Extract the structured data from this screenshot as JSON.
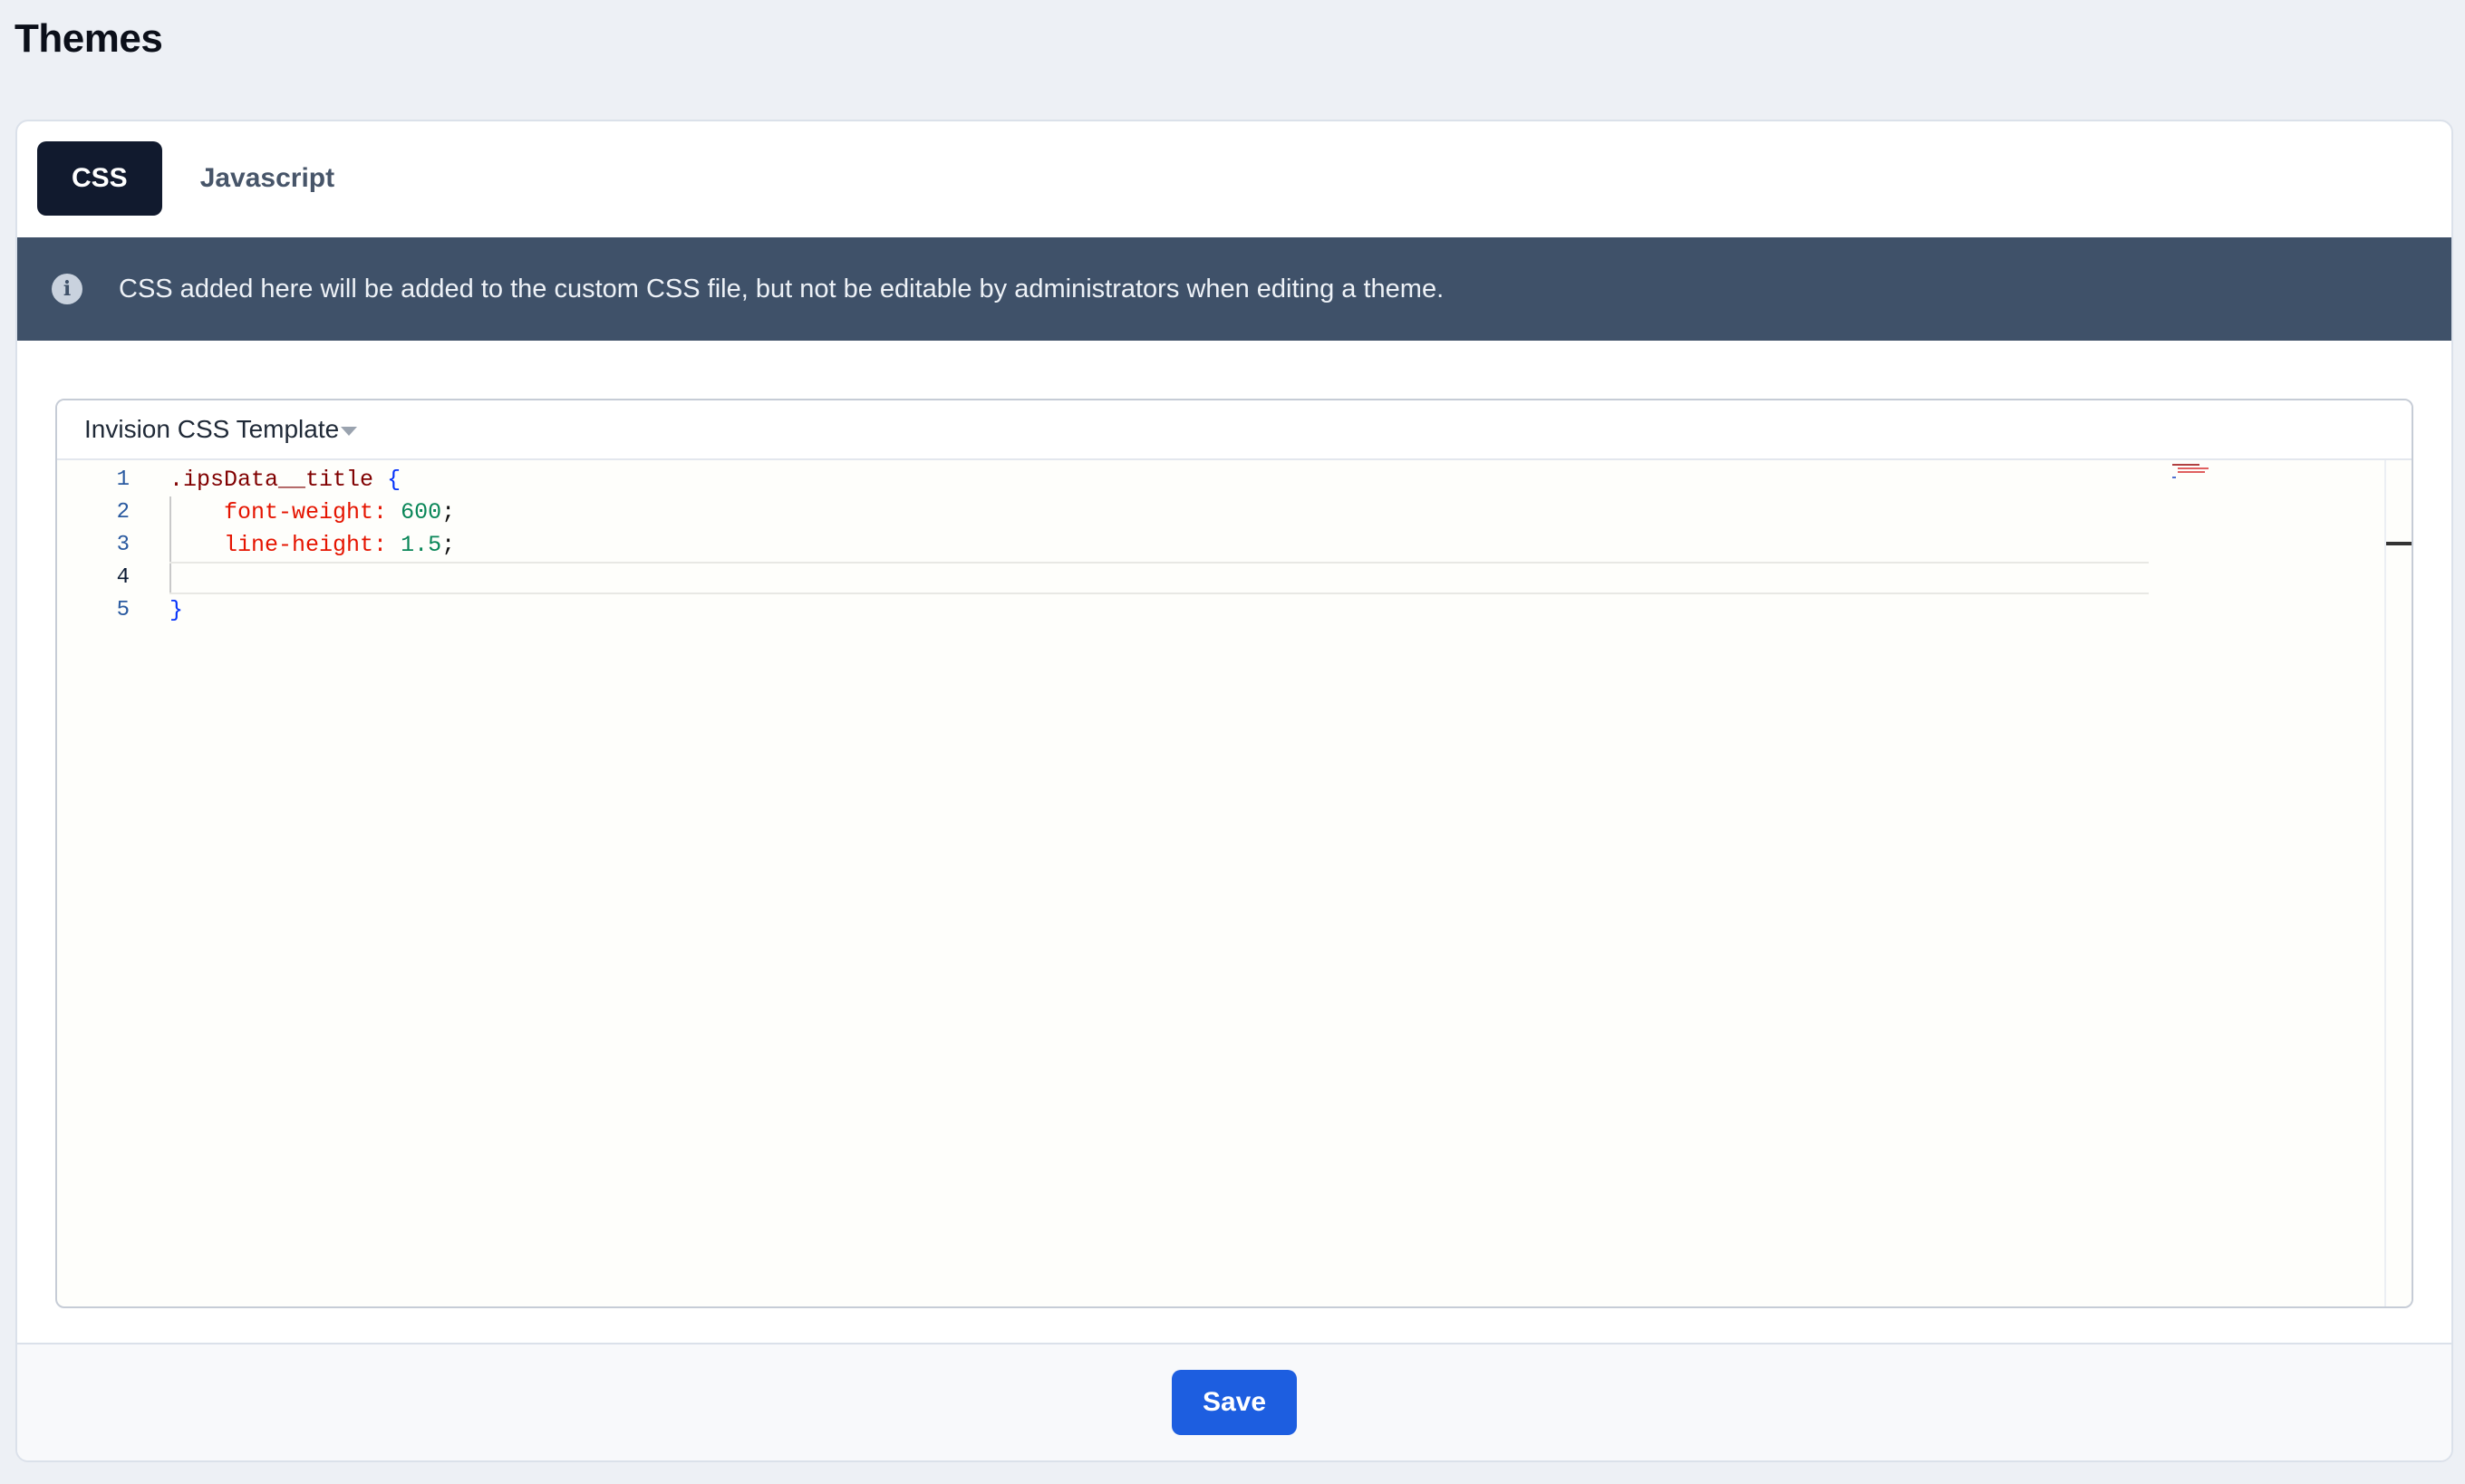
{
  "page": {
    "title": "Themes"
  },
  "tabs": [
    {
      "label": "CSS",
      "active": true
    },
    {
      "label": "Javascript",
      "active": false
    }
  ],
  "info": {
    "icon": "info-icon",
    "text": "CSS added here will be added to the custom CSS file, but not be editable by administrators when editing a theme."
  },
  "editor": {
    "template_label": "Invision CSS Template",
    "line_numbers": [
      "1",
      "2",
      "3",
      "4",
      "5"
    ],
    "current_line": 4,
    "code": {
      "line1_selector": ".ipsData__title",
      "line1_brace": "{",
      "line2_prop": "font-weight:",
      "line2_value": "600",
      "line2_semi": ";",
      "line3_prop": "line-height:",
      "line3_value": "1.5",
      "line3_semi": ";",
      "line5_brace": "}"
    }
  },
  "footer": {
    "save_label": "Save"
  },
  "colors": {
    "accent": "#1d5ee0",
    "info_bar": "#3f5169",
    "active_tab": "#111a2e"
  }
}
